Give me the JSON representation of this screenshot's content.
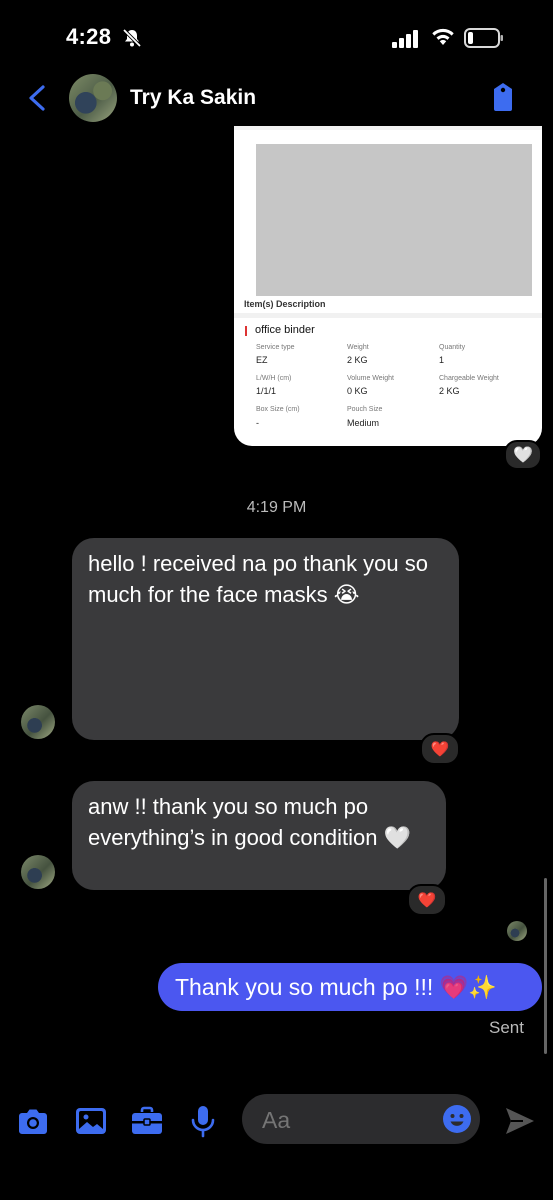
{
  "status_bar": {
    "time": "4:28",
    "icons": [
      "bell-muted-icon",
      "signal-icon",
      "wifi-icon",
      "battery-icon"
    ]
  },
  "header": {
    "contact_name": "Try Ka Sakin",
    "icons": [
      "back-chevron-icon",
      "tag-icon"
    ]
  },
  "shared_card": {
    "section_title": "Item(s) Description",
    "item_name": "office binder",
    "fields": [
      {
        "label": "Service type",
        "value": "EZ"
      },
      {
        "label": "Weight",
        "value": "2 KG"
      },
      {
        "label": "Quantity",
        "value": "1"
      },
      {
        "label": "L/W/H (cm)",
        "value": "1/1/1"
      },
      {
        "label": "Volume Weight",
        "value": "0 KG"
      },
      {
        "label": "Chargeable Weight",
        "value": "2 KG"
      },
      {
        "label": "Box Size (cm)",
        "value": "-"
      },
      {
        "label": "Pouch Size",
        "value": "Medium"
      }
    ],
    "reaction": "🤍"
  },
  "timestamp": "4:19 PM",
  "messages": [
    {
      "text": "hello ! received na po thank you so much for the face masks 😭",
      "reaction": "❤️"
    },
    {
      "text": "anw !! thank you so much po everything’s in good condition 🤍",
      "reaction": "❤️"
    }
  ],
  "outgoing": {
    "text": "Thank you so much po !!! 💗✨",
    "status": "Sent"
  },
  "composer": {
    "placeholder": "Aa",
    "icons": [
      "camera-icon",
      "gallery-icon",
      "briefcase-icon",
      "microphone-icon",
      "emoji-icon",
      "send-icon"
    ]
  },
  "colors": {
    "accent": "#4b57f0",
    "incoming_bubble": "#3a3a3c",
    "background": "#000000",
    "icon_blue": "#3d6cf0"
  }
}
